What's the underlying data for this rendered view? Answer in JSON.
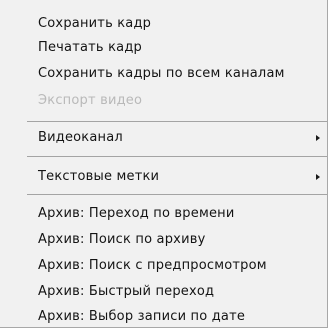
{
  "menu": {
    "items": [
      {
        "label": "Сохранить кадр"
      },
      {
        "label": "Печатать кадр"
      },
      {
        "label": "Сохранить кадры по всем каналам"
      },
      {
        "label": "Экспорт видео",
        "disabled": true
      },
      {
        "label": "Видеоканал",
        "submenu": true
      },
      {
        "label": "Текстовые метки",
        "submenu": true
      },
      {
        "label": "Архив: Переход по времени"
      },
      {
        "label": "Архив: Поиск по архиву"
      },
      {
        "label": "Архив: Поиск с предпросмотром"
      },
      {
        "label": "Архив: Быстрый переход"
      },
      {
        "label": "Архив: Выбор записи по дате"
      }
    ],
    "submenu_arrow_icon": "triangle-right-icon",
    "colors": {
      "background": "#f1f1f1",
      "text": "#141414",
      "disabled_text": "#b9b9b9",
      "separator": "#a4a4a4"
    }
  }
}
